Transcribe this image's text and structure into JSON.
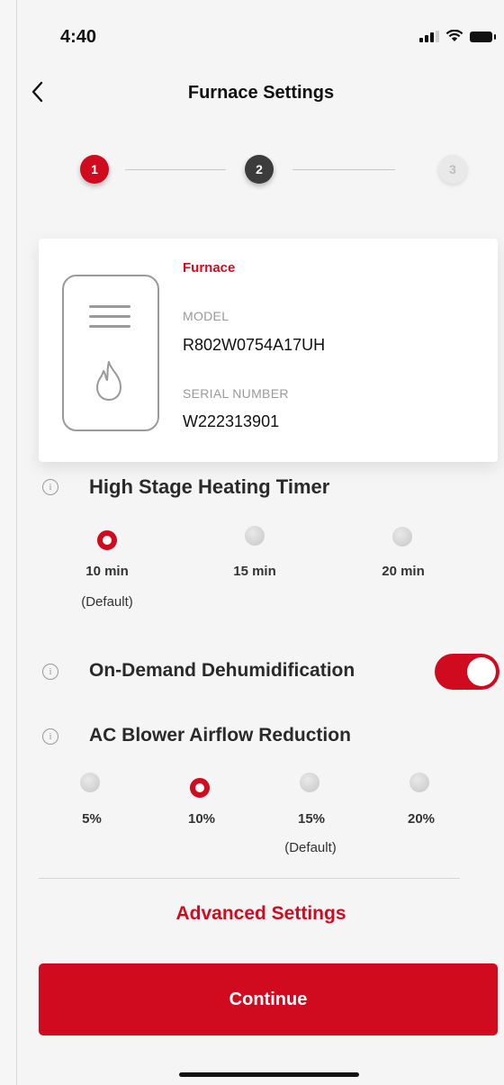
{
  "status_bar": {
    "time": "4:40"
  },
  "header": {
    "back_icon": "chevron-left-icon",
    "title": "Furnace Settings"
  },
  "stepper": {
    "steps": [
      "1",
      "2",
      "3"
    ],
    "current": 1
  },
  "device_card": {
    "type": "Furnace",
    "model_label": "MODEL",
    "model_value": "R802W0754A17UH",
    "serial_label": "SERIAL NUMBER",
    "serial_value": "W222313901"
  },
  "high_stage_timer": {
    "title": "High Stage Heating Timer",
    "options": [
      "10 min",
      "15 min",
      "20 min"
    ],
    "selected_index": 0,
    "default_note": "(Default)"
  },
  "dehumidification": {
    "title": "On-Demand Dehumidification",
    "enabled": true
  },
  "airflow_reduction": {
    "title": "AC Blower Airflow Reduction",
    "options": [
      "5%",
      "10%",
      "15%",
      "20%"
    ],
    "selected_index": 1,
    "default_note": "(Default)"
  },
  "advanced_settings_label": "Advanced Settings",
  "continue_label": "Continue",
  "colors": {
    "accent": "#d10b1f",
    "dark": "#3c3c3c",
    "background": "#f5f5f5"
  }
}
